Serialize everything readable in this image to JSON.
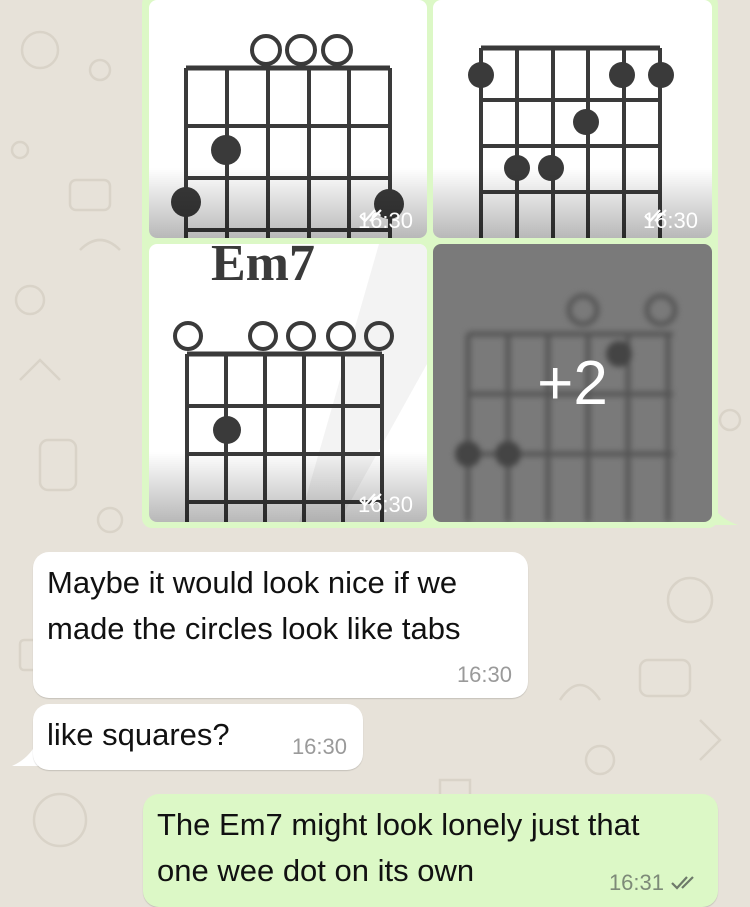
{
  "colors": {
    "chat_background": "#e7e2d9",
    "incoming_bubble": "#ffffff",
    "outgoing_bubble": "#dcf8c6",
    "read_ticks": "#4a4a4a"
  },
  "media_group": {
    "tiles": [
      {
        "time": "16:30",
        "status_icon": "double-check-icon"
      },
      {
        "time": "16:30",
        "status_icon": "double-check-icon"
      },
      {
        "chord_label": "Em7",
        "time": "16:30",
        "status_icon": "double-check-icon"
      }
    ],
    "more_count": "+2"
  },
  "messages": [
    {
      "direction": "incoming",
      "lines": [
        "Maybe it would look nice if we",
        "made the circles look like tabs"
      ],
      "time": "16:30"
    },
    {
      "direction": "incoming",
      "lines": [
        "like squares?"
      ],
      "time": "16:30"
    },
    {
      "direction": "outgoing",
      "lines": [
        "The Em7 might look lonely just that",
        "one wee dot on its own"
      ],
      "time": "16:31",
      "status_icon": "double-check-icon"
    }
  ]
}
